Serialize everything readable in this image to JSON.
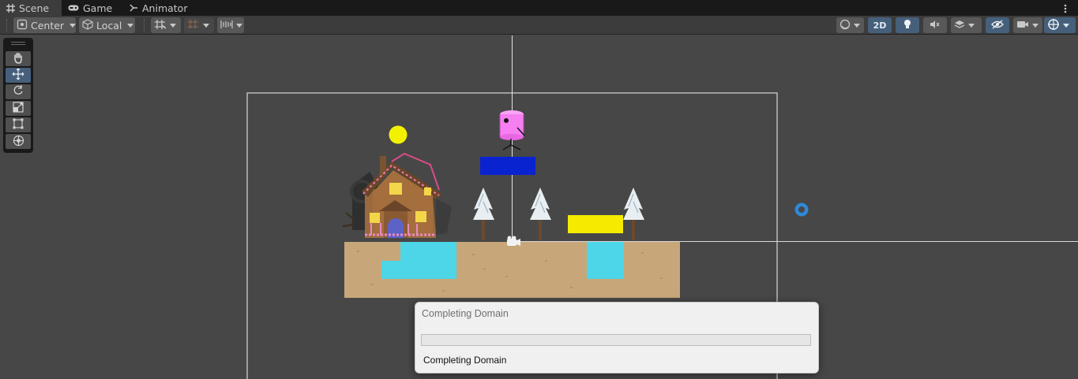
{
  "tabs": [
    {
      "label": "Scene",
      "icon": "grid-icon",
      "active": true
    },
    {
      "label": "Game",
      "icon": "gamepad-icon",
      "active": false
    },
    {
      "label": "Animator",
      "icon": "animator-icon",
      "active": false
    }
  ],
  "toolbar": {
    "pivot_label": "Center",
    "space_label": "Local",
    "mode_2d_label": "2D",
    "right_icons": [
      "shading-sphere-icon",
      "lightbulb-icon",
      "audio-mute-icon",
      "effects-stack-icon",
      "visibility-eye-icon",
      "camera-icon",
      "gizmos-icon"
    ],
    "left_icons": [
      "grid-snap-icon",
      "increment-snap-icon",
      "align-icon"
    ]
  },
  "tool_palette": {
    "items": [
      "hand-tool-icon",
      "move-tool-icon",
      "rotate-tool-icon",
      "scale-tool-icon",
      "rect-tool-icon",
      "transform-tool-icon"
    ],
    "active": "move-tool-icon"
  },
  "scene": {
    "objects": [
      "sun",
      "gingerbread-house",
      "pink-player",
      "blue-platform",
      "yellow-platform",
      "ground",
      "water-pools",
      "snowy-trees",
      "camera-gizmo",
      "light-gizmo"
    ]
  },
  "colors": {
    "sun": "#f2f200",
    "blue_platform": "#0a23d0",
    "yellow_platform": "#f5ea00",
    "water": "#4dd5e8",
    "ground": "#c7a77a",
    "player": "#f57ef0",
    "accent": "#46607c",
    "progress_fill": "#06b025"
  },
  "dialog": {
    "title": "Completing Domain",
    "status": "Completing Domain",
    "progress": 0
  }
}
